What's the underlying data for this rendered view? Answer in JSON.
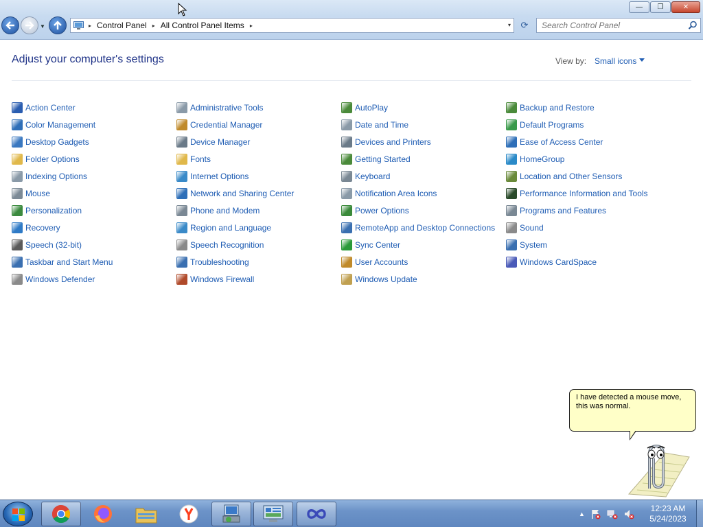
{
  "window": {
    "minimize_glyph": "—",
    "maximize_glyph": "❐",
    "close_glyph": "✕"
  },
  "address": {
    "crumbs": [
      "Control Panel",
      "All Control Panel Items"
    ],
    "separator": "▸",
    "dropdown": "▾",
    "refresh": "⟳"
  },
  "search": {
    "placeholder": "Search Control Panel",
    "value": ""
  },
  "main": {
    "title": "Adjust your computer's settings",
    "view_by_label": "View by:",
    "view_by_value": "Small icons"
  },
  "items": [
    {
      "label": "Action Center",
      "icon": "flag-icon",
      "color": "#2a5db0"
    },
    {
      "label": "Color Management",
      "icon": "monitor-color-icon",
      "color": "#2f6fb8"
    },
    {
      "label": "Desktop Gadgets",
      "icon": "gadgets-icon",
      "color": "#3a78c0"
    },
    {
      "label": "Folder Options",
      "icon": "folder-icon",
      "color": "#e0b84a"
    },
    {
      "label": "Indexing Options",
      "icon": "indexing-icon",
      "color": "#8a9aa8"
    },
    {
      "label": "Mouse",
      "icon": "mouse-icon",
      "color": "#7c8a96"
    },
    {
      "label": "Personalization",
      "icon": "personalization-icon",
      "color": "#3b8a3e"
    },
    {
      "label": "Recovery",
      "icon": "recovery-icon",
      "color": "#2e7ac6"
    },
    {
      "label": "Speech (32-bit)",
      "icon": "speech-icon",
      "color": "#5a5a5a"
    },
    {
      "label": "Taskbar and Start Menu",
      "icon": "taskbar-icon",
      "color": "#3a6fb0"
    },
    {
      "label": "Windows Defender",
      "icon": "defender-icon",
      "color": "#8a8a8a"
    },
    {
      "label": "Administrative Tools",
      "icon": "admin-tools-icon",
      "color": "#8a9aa8"
    },
    {
      "label": "Credential Manager",
      "icon": "credential-icon",
      "color": "#c08a2a"
    },
    {
      "label": "Device Manager",
      "icon": "device-manager-icon",
      "color": "#6a7a88"
    },
    {
      "label": "Fonts",
      "icon": "fonts-icon",
      "color": "#e0b84a"
    },
    {
      "label": "Internet Options",
      "icon": "internet-options-icon",
      "color": "#3a8ac8"
    },
    {
      "label": "Network and Sharing Center",
      "icon": "network-icon",
      "color": "#2e6fb8"
    },
    {
      "label": "Phone and Modem",
      "icon": "phone-modem-icon",
      "color": "#7a8894"
    },
    {
      "label": "Region and Language",
      "icon": "region-icon",
      "color": "#3a8ac8"
    },
    {
      "label": "Speech Recognition",
      "icon": "microphone-icon",
      "color": "#8a8a8a"
    },
    {
      "label": "Troubleshooting",
      "icon": "troubleshooting-icon",
      "color": "#3a6fb0"
    },
    {
      "label": "Windows Firewall",
      "icon": "firewall-icon",
      "color": "#b04a2a"
    },
    {
      "label": "AutoPlay",
      "icon": "autoplay-icon",
      "color": "#4a8a3a"
    },
    {
      "label": "Date and Time",
      "icon": "clock-icon",
      "color": "#8a9aa8"
    },
    {
      "label": "Devices and Printers",
      "icon": "printer-icon",
      "color": "#6a7a88"
    },
    {
      "label": "Getting Started",
      "icon": "getting-started-icon",
      "color": "#4a8a3a"
    },
    {
      "label": "Keyboard",
      "icon": "keyboard-icon",
      "color": "#7a8894"
    },
    {
      "label": "Notification Area Icons",
      "icon": "notification-icon",
      "color": "#8a9aa8"
    },
    {
      "label": "Power Options",
      "icon": "power-icon",
      "color": "#3a8a3a"
    },
    {
      "label": "RemoteApp and Desktop Connections",
      "icon": "remoteapp-icon",
      "color": "#3a6fb0"
    },
    {
      "label": "Sync Center",
      "icon": "sync-icon",
      "color": "#2a9a3a"
    },
    {
      "label": "User Accounts",
      "icon": "user-accounts-icon",
      "color": "#c08a2a"
    },
    {
      "label": "Windows Update",
      "icon": "windows-update-icon",
      "color": "#c0a050"
    },
    {
      "label": "Backup and Restore",
      "icon": "backup-icon",
      "color": "#4a8a3a"
    },
    {
      "label": "Default Programs",
      "icon": "default-programs-icon",
      "color": "#3a9a4a"
    },
    {
      "label": "Ease of Access Center",
      "icon": "ease-of-access-icon",
      "color": "#2e6fb8"
    },
    {
      "label": "HomeGroup",
      "icon": "homegroup-icon",
      "color": "#2a8ac8"
    },
    {
      "label": "Location and Other Sensors",
      "icon": "sensors-icon",
      "color": "#6a8a3a"
    },
    {
      "label": "Performance Information and Tools",
      "icon": "performance-icon",
      "color": "#2a4a2a"
    },
    {
      "label": "Programs and Features",
      "icon": "programs-icon",
      "color": "#7a8894"
    },
    {
      "label": "Sound",
      "icon": "speaker-icon",
      "color": "#8a8a8a"
    },
    {
      "label": "System",
      "icon": "system-icon",
      "color": "#3a6fb0"
    },
    {
      "label": "Windows CardSpace",
      "icon": "cardspace-icon",
      "color": "#4a5ab8"
    }
  ],
  "assistant": {
    "message": "I have detected a mouse move, this was normal."
  },
  "taskbar": {
    "apps": [
      {
        "name": "chrome-icon",
        "active": true
      },
      {
        "name": "firefox-icon",
        "active": false
      },
      {
        "name": "file-explorer-icon",
        "active": false
      },
      {
        "name": "yandex-icon",
        "active": false
      },
      {
        "name": "setup-icon",
        "active": true
      },
      {
        "name": "control-panel-icon",
        "active": true
      },
      {
        "name": "app-infinity-icon",
        "active": true
      }
    ],
    "time": "12:23 AM",
    "date": "5/24/2023",
    "tray_expand": "▲"
  }
}
